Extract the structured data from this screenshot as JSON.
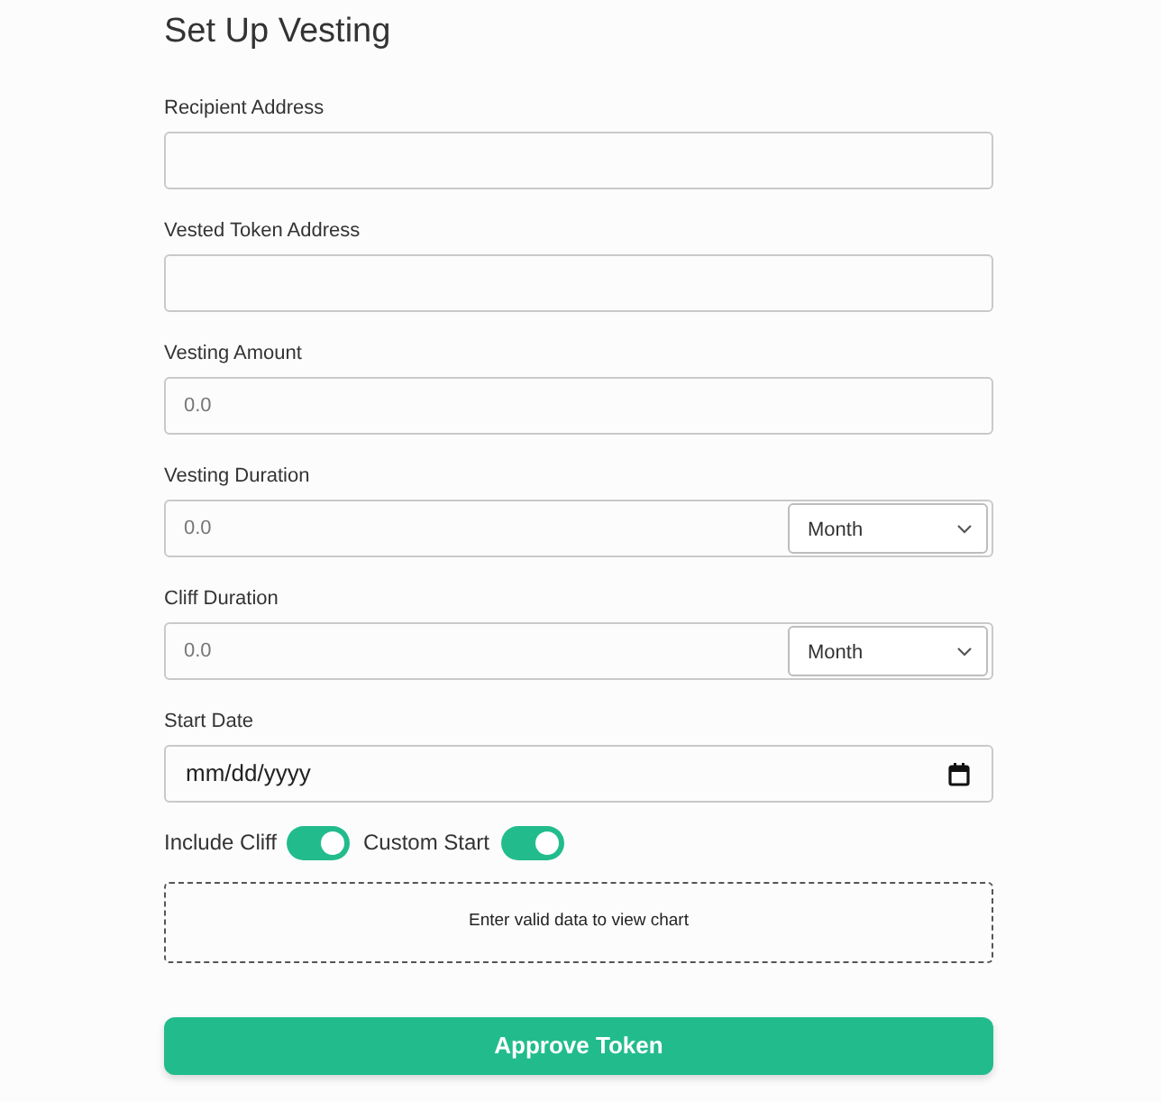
{
  "title": "Set Up Vesting",
  "fields": [
    {
      "kind": "text",
      "label": "Recipient Address"
    },
    {
      "kind": "text",
      "label": "Vested Token Address"
    },
    {
      "kind": "text",
      "label": "Vesting Amount",
      "placeholder": "0.0"
    },
    {
      "kind": "duration",
      "label": "Vesting Duration",
      "placeholder": "0.0",
      "unit": "Month"
    },
    {
      "kind": "duration",
      "label": "Cliff Duration",
      "placeholder": "0.0",
      "unit": "Month"
    },
    {
      "kind": "date",
      "label": "Start Date",
      "value": "mm/dd/yyyy"
    }
  ],
  "toggles": [
    {
      "label": "Include Cliff",
      "on": true
    },
    {
      "label": "Custom Start",
      "on": true
    }
  ],
  "chart_placeholder": {
    "message": "Enter valid data to view chart"
  },
  "submit_button": {
    "label": "Approve Token"
  }
}
